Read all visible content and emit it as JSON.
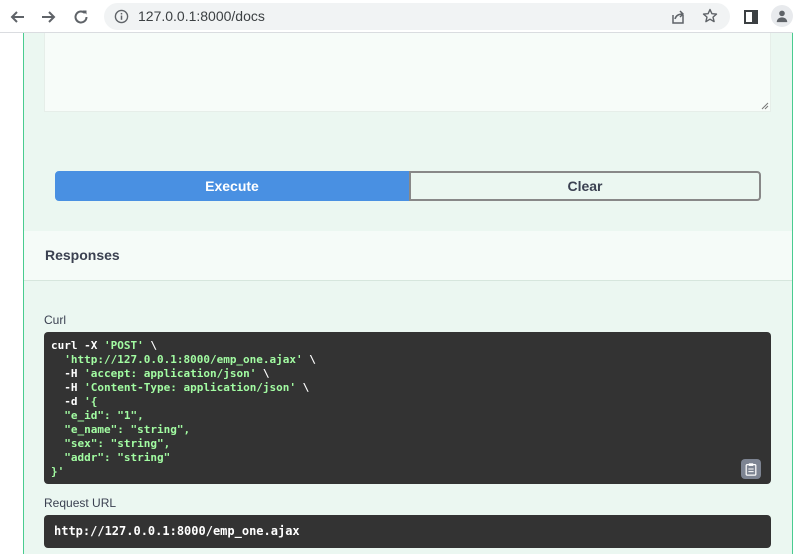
{
  "browser": {
    "url": "127.0.0.1:8000/docs"
  },
  "execute_label": "Execute",
  "clear_label": "Clear",
  "responses_title": "Responses",
  "curl": {
    "label": "Curl",
    "lines": [
      [
        {
          "t": "curl -X ",
          "s": false
        },
        {
          "t": "'POST'",
          "s": true
        },
        {
          "t": " \\",
          "s": false
        }
      ],
      [
        {
          "t": "  ",
          "s": false
        },
        {
          "t": "'http://127.0.0.1:8000/emp_one.ajax'",
          "s": true
        },
        {
          "t": " \\",
          "s": false
        }
      ],
      [
        {
          "t": "  -H ",
          "s": false
        },
        {
          "t": "'accept: application/json'",
          "s": true
        },
        {
          "t": " \\",
          "s": false
        }
      ],
      [
        {
          "t": "  -H ",
          "s": false
        },
        {
          "t": "'Content-Type: application/json'",
          "s": true
        },
        {
          "t": " \\",
          "s": false
        }
      ],
      [
        {
          "t": "  -d ",
          "s": false
        },
        {
          "t": "'{",
          "s": true
        }
      ],
      [
        {
          "t": "  ",
          "s": false
        },
        {
          "t": "\"e_id\": \"1\",",
          "s": true
        }
      ],
      [
        {
          "t": "  ",
          "s": false
        },
        {
          "t": "\"e_name\": \"string\",",
          "s": true
        }
      ],
      [
        {
          "t": "  ",
          "s": false
        },
        {
          "t": "\"sex\": \"string\",",
          "s": true
        }
      ],
      [
        {
          "t": "  ",
          "s": false
        },
        {
          "t": "\"addr\": \"string\"",
          "s": true
        }
      ],
      [
        {
          "t": "}'",
          "s": true
        }
      ]
    ]
  },
  "request_url": {
    "label": "Request URL",
    "value": "http://127.0.0.1:8000/emp_one.ajax"
  }
}
